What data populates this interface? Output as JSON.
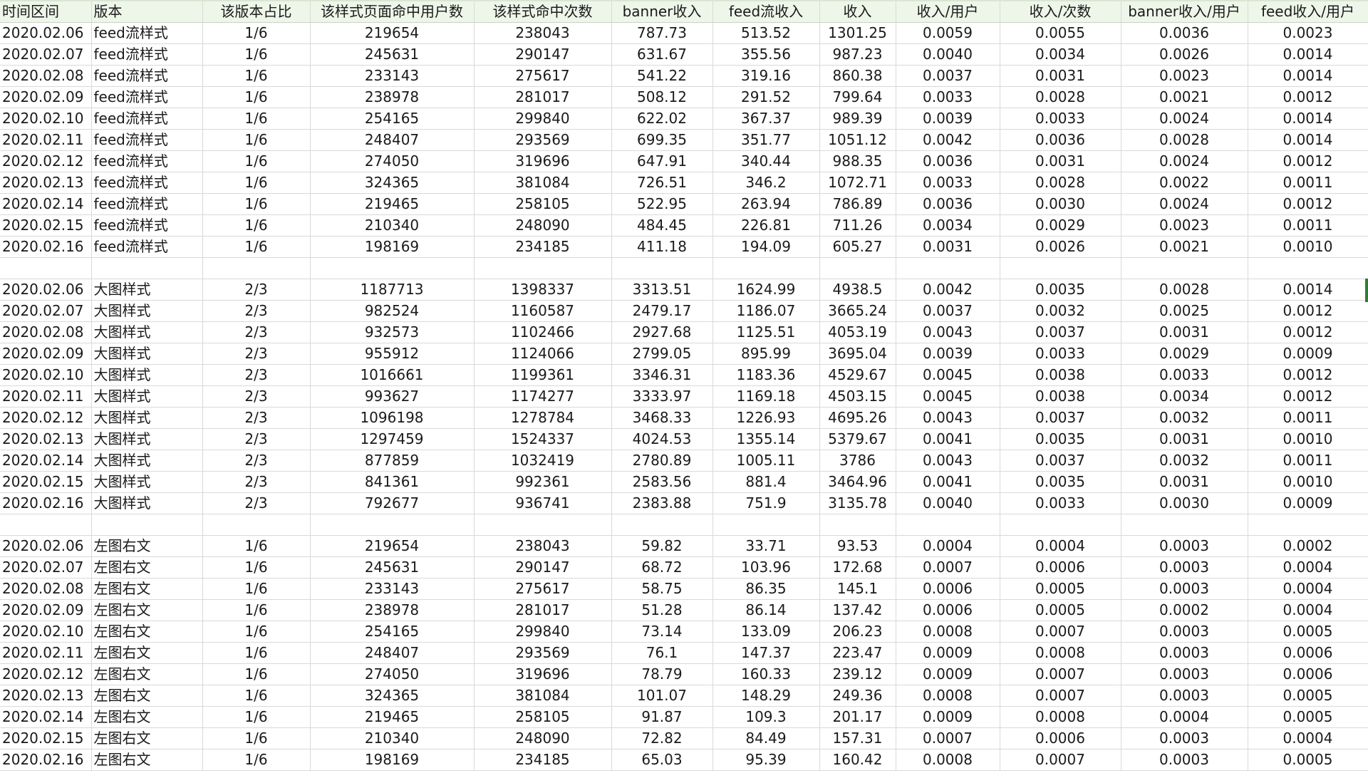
{
  "columns": [
    "时间区间",
    "版本",
    "该版本占比",
    "该样式页面命中用户数",
    "该样式命中次数",
    "banner收入",
    "feed流收入",
    "收入",
    "收入/用户",
    "收入/次数",
    "banner收入/用户",
    "feed收入/用户"
  ],
  "groups": [
    {
      "rows": [
        [
          "2020.02.06",
          "feed流样式",
          "1/6",
          "219654",
          "238043",
          "787.73",
          "513.52",
          "1301.25",
          "0.0059",
          "0.0055",
          "0.0036",
          "0.0023"
        ],
        [
          "2020.02.07",
          "feed流样式",
          "1/6",
          "245631",
          "290147",
          "631.67",
          "355.56",
          "987.23",
          "0.0040",
          "0.0034",
          "0.0026",
          "0.0014"
        ],
        [
          "2020.02.08",
          "feed流样式",
          "1/6",
          "233143",
          "275617",
          "541.22",
          "319.16",
          "860.38",
          "0.0037",
          "0.0031",
          "0.0023",
          "0.0014"
        ],
        [
          "2020.02.09",
          "feed流样式",
          "1/6",
          "238978",
          "281017",
          "508.12",
          "291.52",
          "799.64",
          "0.0033",
          "0.0028",
          "0.0021",
          "0.0012"
        ],
        [
          "2020.02.10",
          "feed流样式",
          "1/6",
          "254165",
          "299840",
          "622.02",
          "367.37",
          "989.39",
          "0.0039",
          "0.0033",
          "0.0024",
          "0.0014"
        ],
        [
          "2020.02.11",
          "feed流样式",
          "1/6",
          "248407",
          "293569",
          "699.35",
          "351.77",
          "1051.12",
          "0.0042",
          "0.0036",
          "0.0028",
          "0.0014"
        ],
        [
          "2020.02.12",
          "feed流样式",
          "1/6",
          "274050",
          "319696",
          "647.91",
          "340.44",
          "988.35",
          "0.0036",
          "0.0031",
          "0.0024",
          "0.0012"
        ],
        [
          "2020.02.13",
          "feed流样式",
          "1/6",
          "324365",
          "381084",
          "726.51",
          "346.2",
          "1072.71",
          "0.0033",
          "0.0028",
          "0.0022",
          "0.0011"
        ],
        [
          "2020.02.14",
          "feed流样式",
          "1/6",
          "219465",
          "258105",
          "522.95",
          "263.94",
          "786.89",
          "0.0036",
          "0.0030",
          "0.0024",
          "0.0012"
        ],
        [
          "2020.02.15",
          "feed流样式",
          "1/6",
          "210340",
          "248090",
          "484.45",
          "226.81",
          "711.26",
          "0.0034",
          "0.0029",
          "0.0023",
          "0.0011"
        ],
        [
          "2020.02.16",
          "feed流样式",
          "1/6",
          "198169",
          "234185",
          "411.18",
          "194.09",
          "605.27",
          "0.0031",
          "0.0026",
          "0.0021",
          "0.0010"
        ]
      ]
    },
    {
      "rows": [
        [
          "2020.02.06",
          "大图样式",
          "2/3",
          "1187713",
          "1398337",
          "3313.51",
          "1624.99",
          "4938.5",
          "0.0042",
          "0.0035",
          "0.0028",
          "0.0014"
        ],
        [
          "2020.02.07",
          "大图样式",
          "2/3",
          "982524",
          "1160587",
          "2479.17",
          "1186.07",
          "3665.24",
          "0.0037",
          "0.0032",
          "0.0025",
          "0.0012"
        ],
        [
          "2020.02.08",
          "大图样式",
          "2/3",
          "932573",
          "1102466",
          "2927.68",
          "1125.51",
          "4053.19",
          "0.0043",
          "0.0037",
          "0.0031",
          "0.0012"
        ],
        [
          "2020.02.09",
          "大图样式",
          "2/3",
          "955912",
          "1124066",
          "2799.05",
          "895.99",
          "3695.04",
          "0.0039",
          "0.0033",
          "0.0029",
          "0.0009"
        ],
        [
          "2020.02.10",
          "大图样式",
          "2/3",
          "1016661",
          "1199361",
          "3346.31",
          "1183.36",
          "4529.67",
          "0.0045",
          "0.0038",
          "0.0033",
          "0.0012"
        ],
        [
          "2020.02.11",
          "大图样式",
          "2/3",
          "993627",
          "1174277",
          "3333.97",
          "1169.18",
          "4503.15",
          "0.0045",
          "0.0038",
          "0.0034",
          "0.0012"
        ],
        [
          "2020.02.12",
          "大图样式",
          "2/3",
          "1096198",
          "1278784",
          "3468.33",
          "1226.93",
          "4695.26",
          "0.0043",
          "0.0037",
          "0.0032",
          "0.0011"
        ],
        [
          "2020.02.13",
          "大图样式",
          "2/3",
          "1297459",
          "1524337",
          "4024.53",
          "1355.14",
          "5379.67",
          "0.0041",
          "0.0035",
          "0.0031",
          "0.0010"
        ],
        [
          "2020.02.14",
          "大图样式",
          "2/3",
          "877859",
          "1032419",
          "2780.89",
          "1005.11",
          "3786",
          "0.0043",
          "0.0037",
          "0.0032",
          "0.0011"
        ],
        [
          "2020.02.15",
          "大图样式",
          "2/3",
          "841361",
          "992361",
          "2583.56",
          "881.4",
          "3464.96",
          "0.0041",
          "0.0035",
          "0.0031",
          "0.0010"
        ],
        [
          "2020.02.16",
          "大图样式",
          "2/3",
          "792677",
          "936741",
          "2383.88",
          "751.9",
          "3135.78",
          "0.0040",
          "0.0033",
          "0.0030",
          "0.0009"
        ]
      ]
    },
    {
      "rows": [
        [
          "2020.02.06",
          "左图右文",
          "1/6",
          "219654",
          "238043",
          "59.82",
          "33.71",
          "93.53",
          "0.0004",
          "0.0004",
          "0.0003",
          "0.0002"
        ],
        [
          "2020.02.07",
          "左图右文",
          "1/6",
          "245631",
          "290147",
          "68.72",
          "103.96",
          "172.68",
          "0.0007",
          "0.0006",
          "0.0003",
          "0.0004"
        ],
        [
          "2020.02.08",
          "左图右文",
          "1/6",
          "233143",
          "275617",
          "58.75",
          "86.35",
          "145.1",
          "0.0006",
          "0.0005",
          "0.0003",
          "0.0004"
        ],
        [
          "2020.02.09",
          "左图右文",
          "1/6",
          "238978",
          "281017",
          "51.28",
          "86.14",
          "137.42",
          "0.0006",
          "0.0005",
          "0.0002",
          "0.0004"
        ],
        [
          "2020.02.10",
          "左图右文",
          "1/6",
          "254165",
          "299840",
          "73.14",
          "133.09",
          "206.23",
          "0.0008",
          "0.0007",
          "0.0003",
          "0.0005"
        ],
        [
          "2020.02.11",
          "左图右文",
          "1/6",
          "248407",
          "293569",
          "76.1",
          "147.37",
          "223.47",
          "0.0009",
          "0.0008",
          "0.0003",
          "0.0006"
        ],
        [
          "2020.02.12",
          "左图右文",
          "1/6",
          "274050",
          "319696",
          "78.79",
          "160.33",
          "239.12",
          "0.0009",
          "0.0007",
          "0.0003",
          "0.0006"
        ],
        [
          "2020.02.13",
          "左图右文",
          "1/6",
          "324365",
          "381084",
          "101.07",
          "148.29",
          "249.36",
          "0.0008",
          "0.0007",
          "0.0003",
          "0.0005"
        ],
        [
          "2020.02.14",
          "左图右文",
          "1/6",
          "219465",
          "258105",
          "91.87",
          "109.3",
          "201.17",
          "0.0009",
          "0.0008",
          "0.0004",
          "0.0005"
        ],
        [
          "2020.02.15",
          "左图右文",
          "1/6",
          "210340",
          "248090",
          "72.82",
          "84.49",
          "157.31",
          "0.0007",
          "0.0006",
          "0.0003",
          "0.0004"
        ],
        [
          "2020.02.16",
          "左图右文",
          "1/6",
          "198169",
          "234185",
          "65.03",
          "95.39",
          "160.42",
          "0.0008",
          "0.0007",
          "0.0003",
          "0.0005"
        ]
      ]
    }
  ]
}
